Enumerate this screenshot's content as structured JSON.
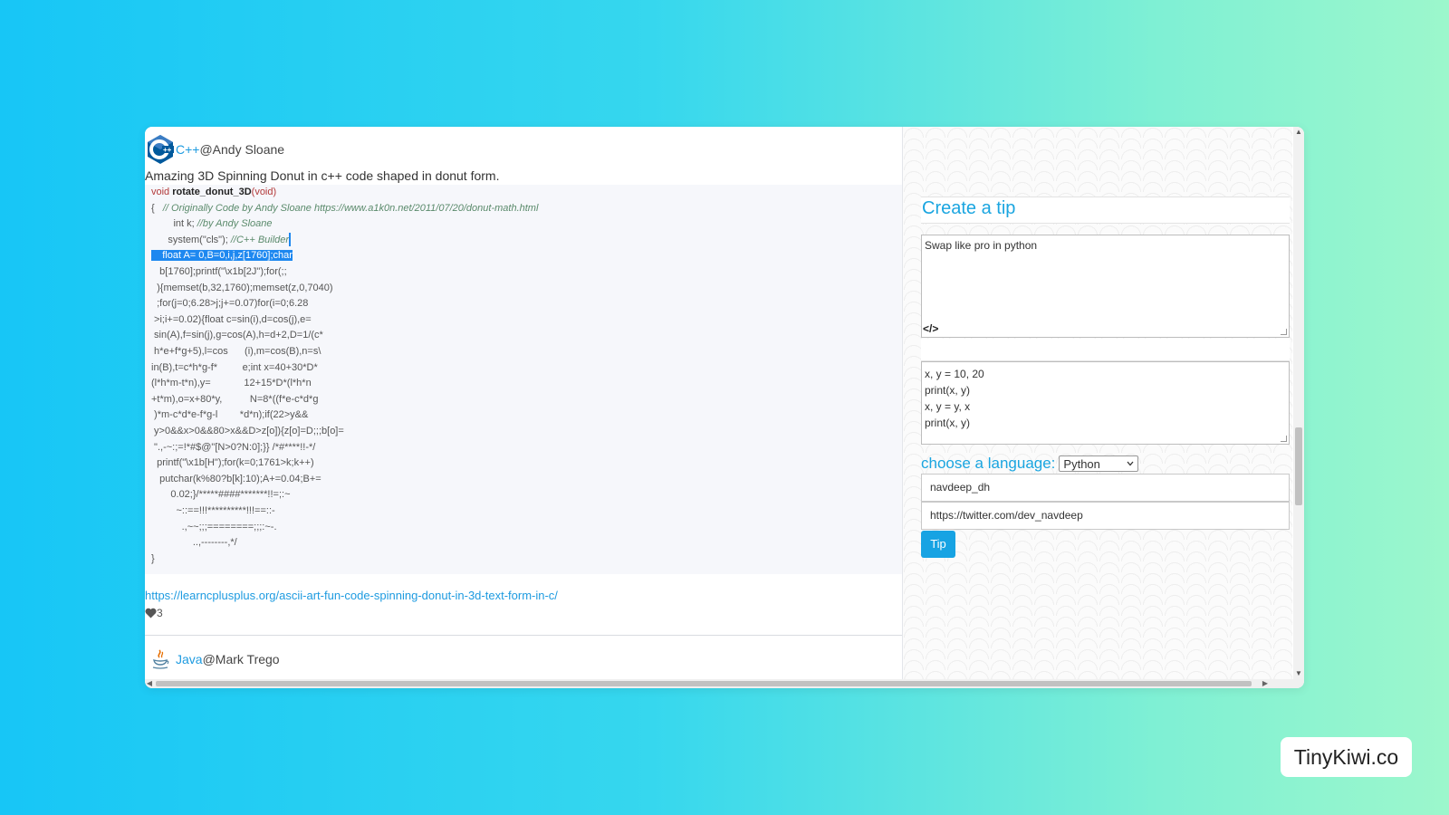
{
  "post1": {
    "language": "C++",
    "author": "@Andy Sloane",
    "description": "Amazing 3D Spinning Donut in c++ code shaped in donut form.",
    "link": "https://learncplusplus.org/ascii-art-fun-code-spinning-donut-in-3d-text-form-in-c/",
    "likes": "3",
    "code": {
      "l1_kw": "void ",
      "l1_fn": "rotate_donut_3D",
      "l1_rest": "(void)",
      "l2_brace": "{   ",
      "l2_comment": "// Originally Code by Andy Sloane https://www.a1k0n.net/2011/07/20/donut-math.html",
      "l3_code": "        int k; ",
      "l3_comment": "//by Andy Sloane",
      "l4_code": "      system(\"cls\"); ",
      "l4_comment": "//C++ Builder",
      "l5_selected": "    float A= 0,B=0,i,j,z[1760];char",
      "l6": "   b[1760];printf(\"\\x1b[2J\");for(;;",
      "l7": "  ){memset(b,32,1760);memset(z,0,7040)",
      "l8": "  ;for(j=0;6.28>j;j+=0.07)for(i=0;6.28",
      "l9": " >i;i+=0.02){float c=sin(i),d=cos(j),e=",
      "l10": " sin(A),f=sin(j),g=cos(A),h=d+2,D=1/(c*",
      "l11": " h*e+f*g+5),l=cos      (i),m=cos(B),n=s\\",
      "l12": "in(B),t=c*h*g-f*         e;int x=40+30*D*",
      "l13": "(l*h*m-t*n),y=            12+15*D*(l*h*n",
      "l14": "+t*m),o=x+80*y,          N=8*((f*e-c*d*g",
      "l15": " )*m-c*d*e-f*g-l        *d*n);if(22>y&&",
      "l16": " y>0&&x>0&&80>x&&D>z[o]){z[o]=D;;;b[o]=",
      "l17": " \".,-~:;=!*#$@\"[N>0?N:0];}} /*#****!!-*/",
      "l18": "  printf(\"\\x1b[H\");for(k=0;1761>k;k++)",
      "l19": "   putchar(k%80?b[k]:10);A+=0.04;B+=",
      "l20": "       0.02;}/*****####*******!!=;:~",
      "l21": "         ~::==!!!**********!!!==::-",
      "l22": "           .,~~;;;========;;;:~-.",
      "l23": "               ..,--------,*/",
      "l24": "}"
    }
  },
  "post2": {
    "language": "Java",
    "author": "@Mark Trego"
  },
  "tip_form": {
    "title": "Create a tip",
    "description": "Swap like pro in python",
    "code_lines": [
      "x, y = 10, 20",
      "print(x, y)",
      "x, y = y, x",
      "print(x, y)"
    ],
    "language_label": "choose a language:",
    "language_selected": "Python",
    "username": "navdeep_dh",
    "profile_url": "https://twitter.com/dev_navdeep",
    "submit_label": "Tip"
  },
  "brand": "TinyKiwi.co"
}
